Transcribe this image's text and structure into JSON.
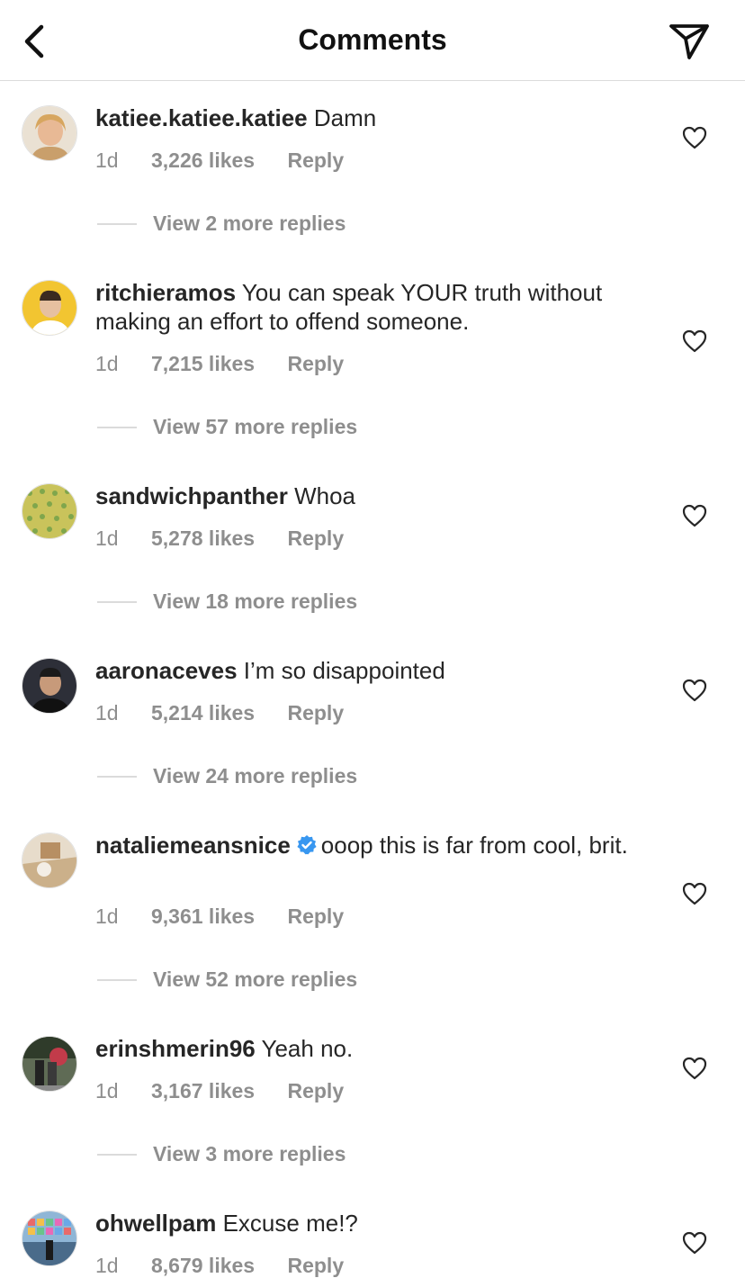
{
  "header": {
    "title": "Comments"
  },
  "comments": [
    {
      "username": "katiee.katiee.katiee",
      "text": "Damn",
      "verified": false,
      "time": "1d",
      "likes": "3,226 likes",
      "reply": "Reply",
      "view_replies": "View 2 more replies",
      "avatar_color": "#d9b27c"
    },
    {
      "username": "ritchieramos",
      "text": "You can speak YOUR truth without making an effort to offend someone.",
      "verified": false,
      "time": "1d",
      "likes": "7,215 likes",
      "reply": "Reply",
      "view_replies": "View 57 more replies",
      "avatar_color": "#f2c531"
    },
    {
      "username": "sandwichpanther",
      "text": "Whoa",
      "verified": false,
      "time": "1d",
      "likes": "5,278 likes",
      "reply": "Reply",
      "view_replies": "View 18 more replies",
      "avatar_color": "#c7c25a"
    },
    {
      "username": "aaronaceves",
      "text": "I’m so disappointed",
      "verified": false,
      "time": "1d",
      "likes": "5,214 likes",
      "reply": "Reply",
      "view_replies": "View 24 more replies",
      "avatar_color": "#2d2f38"
    },
    {
      "username": "nataliemeansnice",
      "text": "ooop this is far from cool, brit.",
      "verified": true,
      "time": "1d",
      "likes": "9,361 likes",
      "reply": "Reply",
      "view_replies": "View 52 more replies",
      "avatar_color": "#cdb89a"
    },
    {
      "username": "erinshmerin96",
      "text": "Yeah no.",
      "verified": false,
      "time": "1d",
      "likes": "3,167 likes",
      "reply": "Reply",
      "view_replies": "View 3 more replies",
      "avatar_color": "#6c7a5a"
    },
    {
      "username": "ohwellpam",
      "text": "Excuse me!?",
      "verified": false,
      "time": "1d",
      "likes": "8,679 likes",
      "reply": "Reply",
      "view_replies": "",
      "avatar_color": "#8fb6d6"
    }
  ]
}
